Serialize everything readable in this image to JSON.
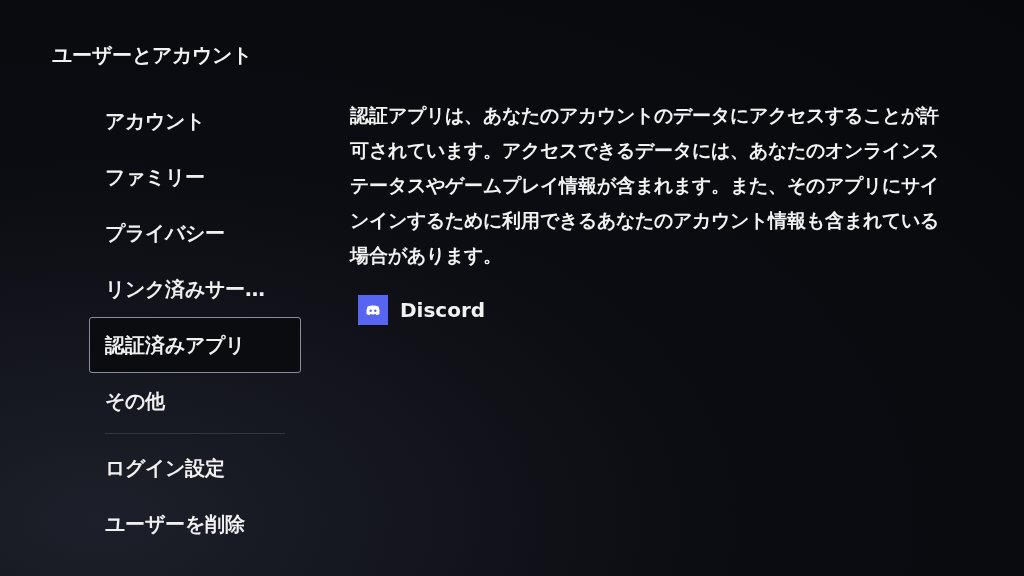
{
  "title": "ユーザーとアカウント",
  "menu": [
    {
      "items": [
        {
          "label": "アカウント",
          "selected": false
        },
        {
          "label": "ファミリー",
          "selected": false
        },
        {
          "label": "プライバシー",
          "selected": false
        },
        {
          "label": "リンク済みサー…",
          "selected": false
        },
        {
          "label": "認証済みアプリ",
          "selected": true
        },
        {
          "label": "その他",
          "selected": false
        }
      ]
    },
    {
      "items": [
        {
          "label": "ログイン設定",
          "selected": false
        },
        {
          "label": "ユーザーを削除",
          "selected": false
        }
      ]
    }
  ],
  "description": "認証アプリは、あなたのアカウントのデータにアクセスすることが許可されています。アクセスできるデータには、あなたのオンラインステータスやゲームプレイ情報が含まれます。また、そのアプリにサインインするために利用できるあなたのアカウント情報も含まれている場合があります。",
  "apps": [
    {
      "name": "Discord",
      "color": "#5865f2"
    }
  ]
}
